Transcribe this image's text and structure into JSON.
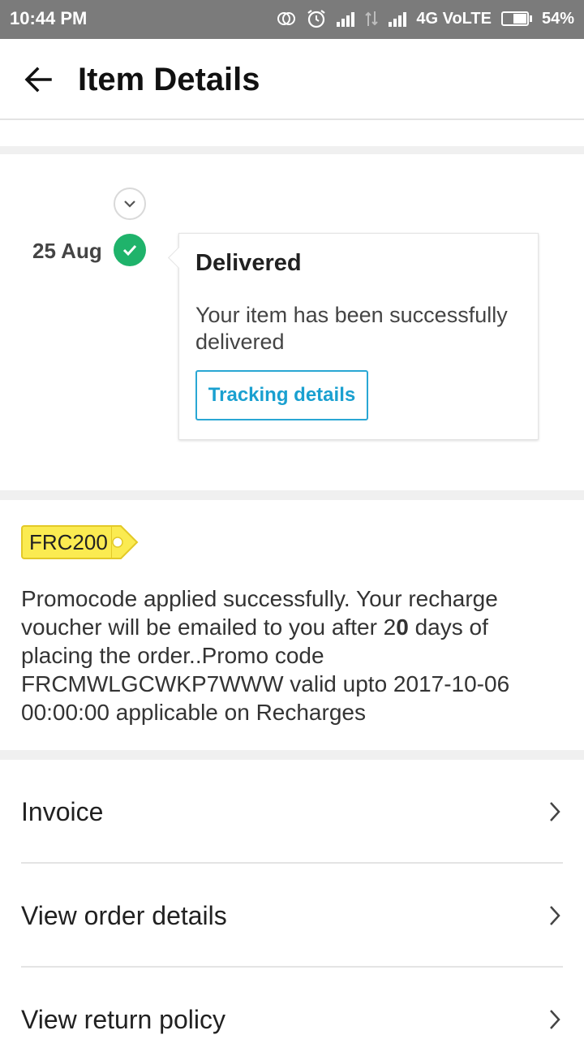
{
  "status_bar": {
    "time": "10:44 PM",
    "network": "4G VoLTE",
    "battery": "54%",
    "battery_level": 0.54
  },
  "app_bar": {
    "title": "Item Details"
  },
  "timeline": {
    "date": "25 Aug",
    "status": "Delivered",
    "description": "Your item has been successfully delivered",
    "tracking_button": "Tracking details"
  },
  "promo": {
    "code": "FRC200",
    "text_before_bold": "Promocode applied successfully. Your recharge voucher will be emailed to you after 2",
    "text_bold": "0",
    "text_after_bold": " days of placing the order..Promo code FRCMWLGCWKP7WWW valid upto 2017-10-06 00:00:00 applicable on Recharges"
  },
  "links": [
    {
      "label": "Invoice"
    },
    {
      "label": "View order details"
    },
    {
      "label": "View return policy"
    }
  ],
  "colors": {
    "status_bar": "#7b7b7b",
    "success_green": "#1fb36b",
    "link_blue": "#1aa0d0",
    "promo_yellow": "#fbeb51"
  }
}
